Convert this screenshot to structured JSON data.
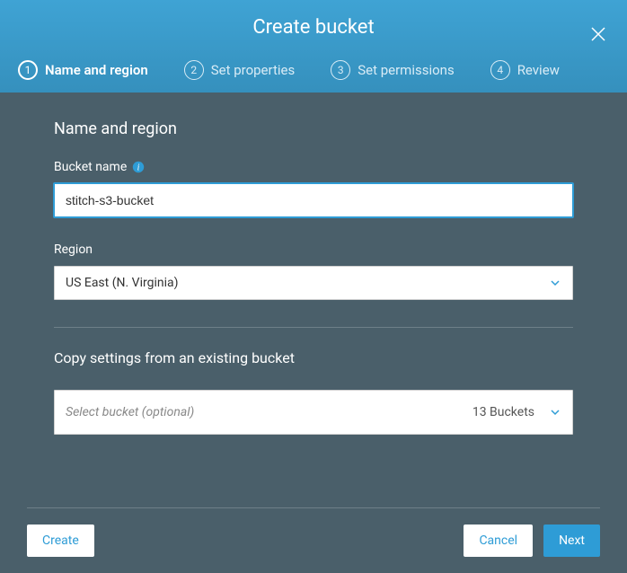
{
  "title": "Create bucket",
  "steps": [
    {
      "num": "1",
      "label": "Name and region"
    },
    {
      "num": "2",
      "label": "Set properties"
    },
    {
      "num": "3",
      "label": "Set permissions"
    },
    {
      "num": "4",
      "label": "Review"
    }
  ],
  "section": {
    "heading": "Name and region"
  },
  "bucketName": {
    "label": "Bucket name",
    "value": "stitch-s3-bucket"
  },
  "region": {
    "label": "Region",
    "selected": "US East (N. Virginia)"
  },
  "copySettings": {
    "heading": "Copy settings from an existing bucket",
    "placeholder": "Select bucket (optional)",
    "count": "13 Buckets"
  },
  "buttons": {
    "create": "Create",
    "cancel": "Cancel",
    "next": "Next"
  }
}
